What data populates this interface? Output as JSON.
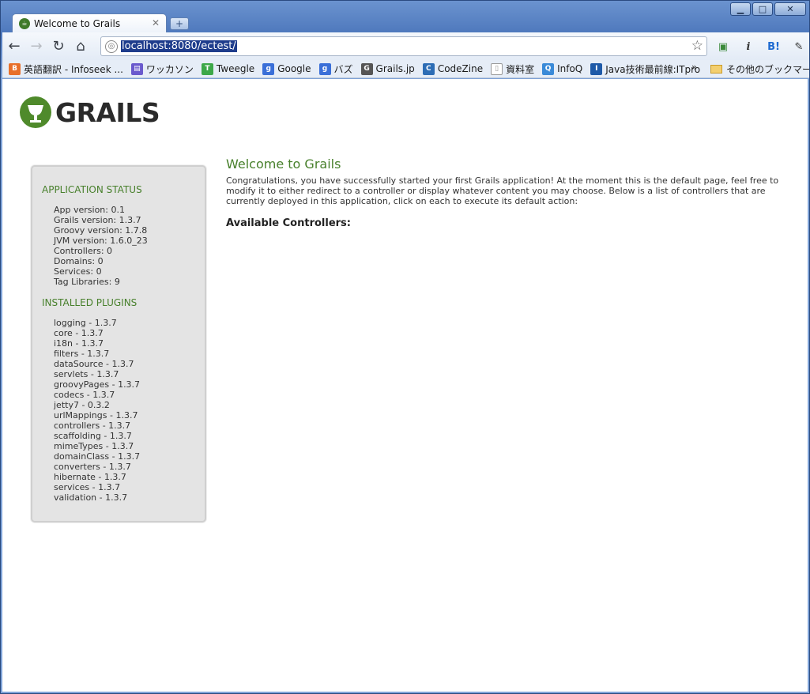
{
  "browser": {
    "tab_title": "Welcome to Grails",
    "url": "localhost:8080/ectest/",
    "window_controls": {
      "minimize": "▁",
      "maximize": "□",
      "close": "✕"
    },
    "bookmarks": [
      {
        "label": "英語翻訳 - Infoseek ...",
        "icon": "blogger-icon",
        "color": "#e8702a"
      },
      {
        "label": "ワッカソン",
        "icon": "page-icon",
        "color": "#6a5acd"
      },
      {
        "label": "Tweegle",
        "icon": "tweegle-icon",
        "color": "#3da849"
      },
      {
        "label": "Google",
        "icon": "google-icon",
        "color": "#3a6fd8"
      },
      {
        "label": "バズ",
        "icon": "google-icon",
        "color": "#3a6fd8"
      },
      {
        "label": "Grails.jp",
        "icon": "grails-icon",
        "color": "#555555"
      },
      {
        "label": "CodeZine",
        "icon": "codezine-icon",
        "color": "#2d6db5"
      },
      {
        "label": "資料室",
        "icon": "document-icon",
        "color": "#999999"
      },
      {
        "label": "InfoQ",
        "icon": "infoq-icon",
        "color": "#3a8ad8"
      },
      {
        "label": "Java技術最前線:ITpro",
        "icon": "itpro-icon",
        "color": "#1e5aa8"
      }
    ],
    "other_bookmarks": "その他のブックマーク",
    "chevron": "»"
  },
  "logo": {
    "text": "GRAILS"
  },
  "status": {
    "application_heading": "APPLICATION STATUS",
    "application_items": [
      "App version: 0.1",
      "Grails version: 1.3.7",
      "Groovy version: 1.7.8",
      "JVM version: 1.6.0_23",
      "Controllers: 0",
      "Domains: 0",
      "Services: 0",
      "Tag Libraries: 9"
    ],
    "plugins_heading": "INSTALLED PLUGINS",
    "plugin_items": [
      "logging - 1.3.7",
      "core - 1.3.7",
      "i18n - 1.3.7",
      "filters - 1.3.7",
      "dataSource - 1.3.7",
      "servlets - 1.3.7",
      "groovyPages - 1.3.7",
      "codecs - 1.3.7",
      "jetty7 - 0.3.2",
      "urlMappings - 1.3.7",
      "controllers - 1.3.7",
      "scaffolding - 1.3.7",
      "mimeTypes - 1.3.7",
      "domainClass - 1.3.7",
      "converters - 1.3.7",
      "hibernate - 1.3.7",
      "services - 1.3.7",
      "validation - 1.3.7"
    ]
  },
  "main": {
    "title": "Welcome to Grails",
    "intro": "Congratulations, you have successfully started your first Grails application! At the moment this is the default page, feel free to modify it to either redirect to a controller or display whatever content you may choose. Below is a list of controllers that are currently deployed in this application, click on each to execute its default action:",
    "controllers_heading": "Available Controllers:"
  }
}
